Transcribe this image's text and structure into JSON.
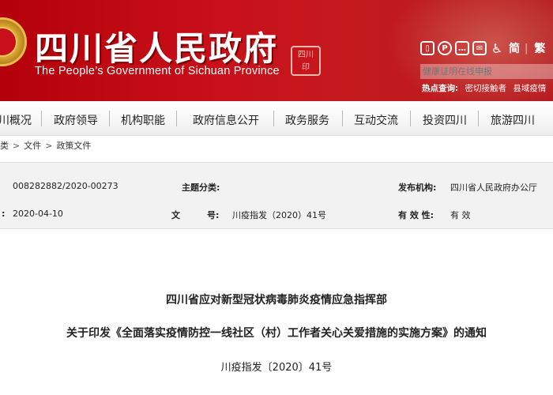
{
  "header": {
    "site_title": "四川省人民政府",
    "site_title_en": "The People’s Government of Sichuan Province",
    "seal_text": "四川 印",
    "toolbar": {
      "icons": [
        "mobile-icon",
        "weibo-icon",
        "wechat-icon",
        "mail-icon",
        "accessibility-icon"
      ],
      "simplified_label": "简",
      "separator": "|",
      "traditional_label": "繁"
    },
    "search": {
      "placeholder": "健康证明在线申报"
    },
    "hot_search": {
      "label": "热点查询:",
      "items": [
        "密切接触者",
        "县域疫情"
      ]
    }
  },
  "nav": {
    "items": [
      "川概况",
      "政府领导",
      "机构职能",
      "政府信息公开",
      "政务服务",
      "互动交流",
      "投资四川",
      "旅游四川"
    ]
  },
  "breadcrumb": {
    "items": [
      "类",
      "文件",
      "政策文件"
    ],
    "separator": ">"
  },
  "info": {
    "index_no": "008282882/2020-00273",
    "topic_label": "主题分类:",
    "topic_value": "",
    "publisher_label": "发布机构:",
    "publisher_value": "四川省人民政府办公厅",
    "date_colon": ":",
    "date_value": "2020-04-10",
    "docno_label_a": "文",
    "docno_label_b": "号:",
    "docno_value": "川疫指发（2020）41号",
    "validity_label": "有 效 性:",
    "validity_value": "有 效"
  },
  "document": {
    "issuer_title": "四川省应对新型冠状病毒肺炎疫情应急指挥部",
    "notice_title": "关于印发《全面落实疫情防控一线社区（村）工作者关心关爱措施的实施方案》的通知",
    "doc_number": "川疫指发〔2020〕41号"
  },
  "colors": {
    "banner_red": "#c8101a",
    "nav_bg": "#f6f6f6",
    "info_bg": "#f2f2f2"
  }
}
